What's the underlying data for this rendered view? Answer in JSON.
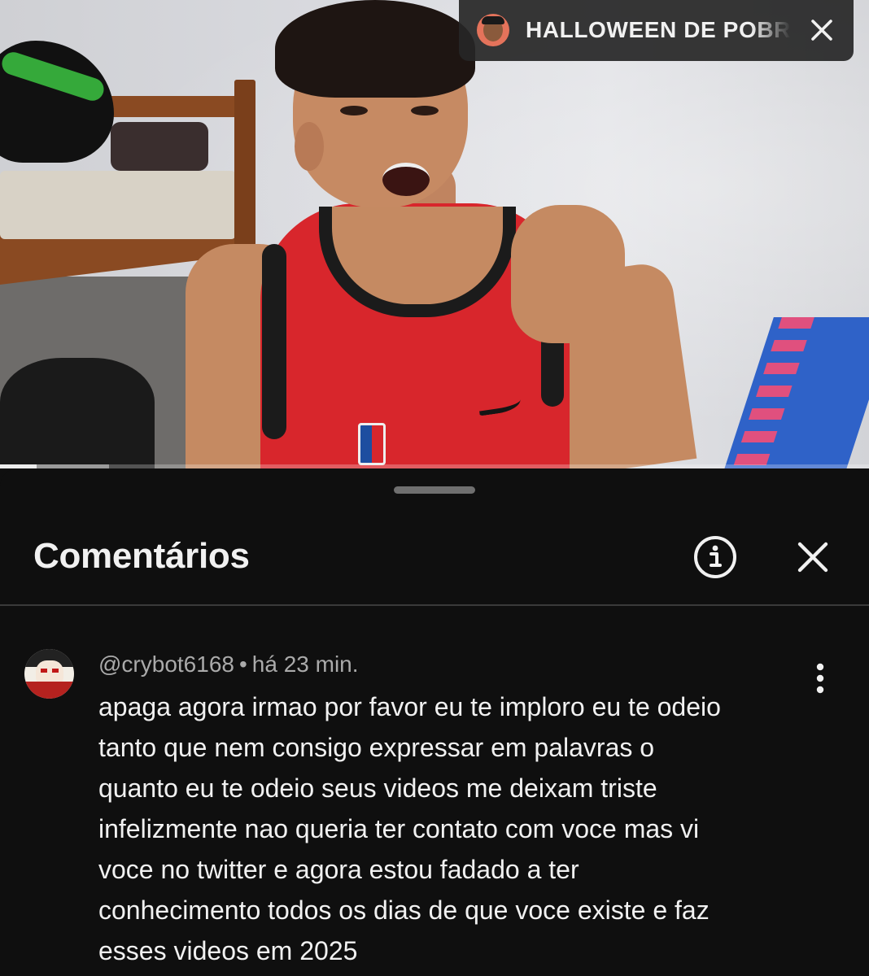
{
  "video": {
    "progress_fraction": 0.042,
    "buffered_fraction": 0.125
  },
  "mini_player": {
    "title": "HALLOWEEN DE POBRE",
    "avatar_icon": "channel-avatar",
    "close_icon": "close-icon"
  },
  "comments_panel": {
    "title": "Comentários",
    "info_icon": "info-icon",
    "close_icon": "close-icon",
    "comments": [
      {
        "author": "@crybot6168",
        "time": "há 23 min.",
        "separator": "•",
        "more_icon": "more-vert-icon",
        "text_lines": [
          "apaga agora irmao por favor eu te imploro eu te odeio",
          "tanto que nem consigo expressar em palavras o",
          "quanto eu te odeio seus videos me deixam triste",
          "infelizmente nao queria ter contato com voce mas vi",
          "voce no twitter e agora estou fadado a ter",
          "conhecimento todos os dias de que voce existe e faz",
          "esses videos em 2025"
        ]
      }
    ]
  },
  "colors": {
    "background": "#0f0f0f",
    "text_primary": "#f1f1f1",
    "text_secondary": "#aaaaaa",
    "divider": "#3a3a3a"
  }
}
